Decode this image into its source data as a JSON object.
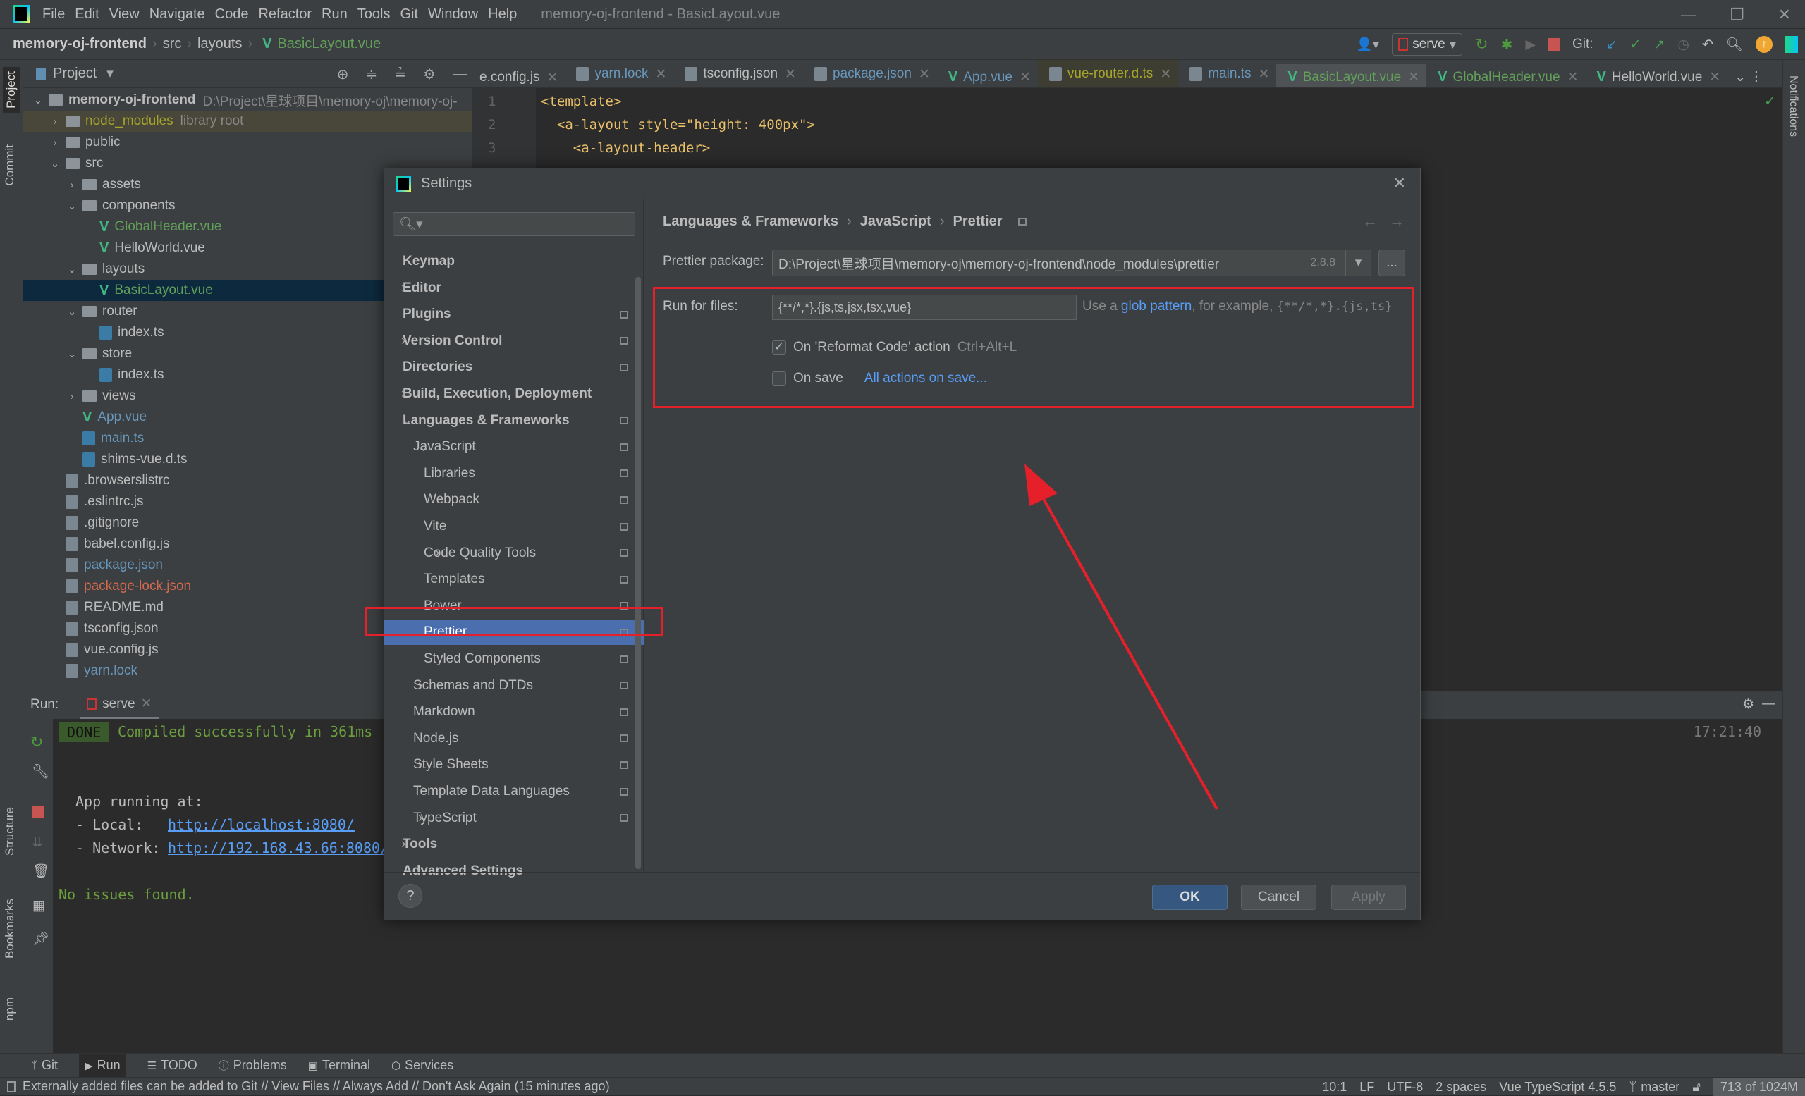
{
  "titlebar": {
    "menu": [
      "File",
      "Edit",
      "View",
      "Navigate",
      "Code",
      "Refactor",
      "Run",
      "Tools",
      "Git",
      "Window",
      "Help"
    ],
    "title": "memory-oj-frontend - BasicLayout.vue"
  },
  "navbar": {
    "breadcrumb": [
      "memory-oj-frontend",
      "src",
      "layouts",
      "BasicLayout.vue"
    ],
    "run_config": "serve",
    "git_label": "Git:"
  },
  "left_stripe": [
    "Project",
    "Commit",
    "Structure",
    "Bookmarks",
    "npm"
  ],
  "right_stripe": [
    "Notifications"
  ],
  "project": {
    "title": "Project",
    "tree": [
      {
        "label": "memory-oj-frontend",
        "extra": "D:\\Project\\星球项目\\memory-oj\\memory-oj-",
        "level": 0,
        "type": "folder",
        "open": true
      },
      {
        "label": "node_modules",
        "extra": "library root",
        "level": 1,
        "type": "folder",
        "open": false
      },
      {
        "label": "public",
        "level": 1,
        "type": "folder",
        "open": false
      },
      {
        "label": "src",
        "level": 1,
        "type": "folder",
        "open": true
      },
      {
        "label": "assets",
        "level": 2,
        "type": "folder",
        "open": false
      },
      {
        "label": "components",
        "level": 2,
        "type": "folder",
        "open": true
      },
      {
        "label": "GlobalHeader.vue",
        "level": 3,
        "type": "vue"
      },
      {
        "label": "HelloWorld.vue",
        "level": 3,
        "type": "vue"
      },
      {
        "label": "layouts",
        "level": 2,
        "type": "folder",
        "open": true
      },
      {
        "label": "BasicLayout.vue",
        "level": 3,
        "type": "vue",
        "selected": true
      },
      {
        "label": "router",
        "level": 2,
        "type": "folder",
        "open": true
      },
      {
        "label": "index.ts",
        "level": 3,
        "type": "ts"
      },
      {
        "label": "store",
        "level": 2,
        "type": "folder",
        "open": true
      },
      {
        "label": "index.ts",
        "level": 3,
        "type": "ts"
      },
      {
        "label": "views",
        "level": 2,
        "type": "folder",
        "open": false
      },
      {
        "label": "App.vue",
        "level": 2,
        "type": "vue"
      },
      {
        "label": "main.ts",
        "level": 2,
        "type": "ts"
      },
      {
        "label": "shims-vue.d.ts",
        "level": 2,
        "type": "ts"
      },
      {
        "label": ".browserslistrc",
        "level": 1,
        "type": "file"
      },
      {
        "label": ".eslintrc.js",
        "level": 1,
        "type": "file"
      },
      {
        "label": ".gitignore",
        "level": 1,
        "type": "file"
      },
      {
        "label": "babel.config.js",
        "level": 1,
        "type": "file"
      },
      {
        "label": "package.json",
        "level": 1,
        "type": "file"
      },
      {
        "label": "package-lock.json",
        "level": 1,
        "type": "file"
      },
      {
        "label": "README.md",
        "level": 1,
        "type": "file"
      },
      {
        "label": "tsconfig.json",
        "level": 1,
        "type": "file"
      },
      {
        "label": "vue.config.js",
        "level": 1,
        "type": "file"
      },
      {
        "label": "yarn.lock",
        "level": 1,
        "type": "file"
      }
    ]
  },
  "tabs": [
    {
      "label": "e.config.js"
    },
    {
      "label": "yarn.lock"
    },
    {
      "label": "tsconfig.json"
    },
    {
      "label": "package.json"
    },
    {
      "label": "App.vue"
    },
    {
      "label": "vue-router.d.ts"
    },
    {
      "label": "main.ts"
    },
    {
      "label": "BasicLayout.vue",
      "active": true
    },
    {
      "label": "GlobalHeader.vue"
    },
    {
      "label": "HelloWorld.vue"
    }
  ],
  "editor": {
    "lines": [
      {
        "n": "1",
        "code": "<template>"
      },
      {
        "n": "2",
        "code": "  <a-layout style=\"height: 400px\">"
      },
      {
        "n": "3",
        "code": "    <a-layout-header>"
      }
    ]
  },
  "run": {
    "label": "Run:",
    "tab": "serve",
    "done": "DONE",
    "compiled": "Compiled successfully in 361ms",
    "time": "17:21:40",
    "app_running": "App running at:",
    "local_label": "- Local:   ",
    "local_url": "http://localhost:8080/",
    "network_label": "- Network: ",
    "network_url": "http://192.168.43.66:8080/",
    "no_issues": "No issues found."
  },
  "toolwindows": [
    "Git",
    "Run",
    "TODO",
    "Problems",
    "Terminal",
    "Services"
  ],
  "status": {
    "message": "Externally added files can be added to Git // View Files // Always Add // Don't Ask Again (15 minutes ago)",
    "position": "10:1",
    "line_sep": "LF",
    "encoding": "UTF-8",
    "indent": "2 spaces",
    "lang": "Vue TypeScript 4.5.5",
    "branch": "master",
    "memory": "713 of 1024M"
  },
  "dialog": {
    "title": "Settings",
    "search_placeholder": "",
    "side": [
      {
        "label": "Keymap",
        "level": 0,
        "bold": true
      },
      {
        "label": "Editor",
        "level": 0,
        "bold": true,
        "arrow": "›"
      },
      {
        "label": "Plugins",
        "level": 0,
        "bold": true,
        "pin": true
      },
      {
        "label": "Version Control",
        "level": 0,
        "bold": true,
        "arrow": "›",
        "pin": true
      },
      {
        "label": "Directories",
        "level": 0,
        "bold": true,
        "pin": true
      },
      {
        "label": "Build, Execution, Deployment",
        "level": 0,
        "bold": true,
        "arrow": "›"
      },
      {
        "label": "Languages & Frameworks",
        "level": 0,
        "bold": true,
        "arrow": "⌄",
        "pin": true
      },
      {
        "label": "JavaScript",
        "level": 1,
        "arrow": "⌄",
        "pin": true
      },
      {
        "label": "Libraries",
        "level": 2,
        "pin": true
      },
      {
        "label": "Webpack",
        "level": 2,
        "pin": true
      },
      {
        "label": "Vite",
        "level": 2,
        "pin": true
      },
      {
        "label": "Code Quality Tools",
        "level": 2,
        "arrow": "›",
        "pin": true
      },
      {
        "label": "Templates",
        "level": 2,
        "pin": true
      },
      {
        "label": "Bower",
        "level": 2,
        "pin": true
      },
      {
        "label": "Prettier",
        "level": 2,
        "pin": true,
        "selected": true
      },
      {
        "label": "Styled Components",
        "level": 2,
        "pin": true
      },
      {
        "label": "Schemas and DTDs",
        "level": 1,
        "arrow": "›",
        "pin": true
      },
      {
        "label": "Markdown",
        "level": 1,
        "pin": true
      },
      {
        "label": "Node.js",
        "level": 1,
        "pin": true
      },
      {
        "label": "Style Sheets",
        "level": 1,
        "arrow": "›",
        "pin": true
      },
      {
        "label": "Template Data Languages",
        "level": 1,
        "pin": true
      },
      {
        "label": "TypeScript",
        "level": 1,
        "arrow": "›",
        "pin": true
      },
      {
        "label": "Tools",
        "level": 0,
        "bold": true,
        "arrow": "›"
      },
      {
        "label": "Advanced Settings",
        "level": 0,
        "bold": true
      }
    ],
    "breadcrumb": [
      "Languages & Frameworks",
      "JavaScript",
      "Prettier"
    ],
    "package_label": "Prettier package:",
    "package_value": "D:\\Project\\星球项目\\memory-oj\\memory-oj-frontend\\node_modules\\prettier",
    "package_version": "2.8.8",
    "browse": "...",
    "run_for_label": "Run for files:",
    "run_for_value": "{**/*,*}.{js,ts,jsx,tsx,vue}",
    "hint_pre": "Use a ",
    "hint_link": "glob pattern",
    "hint_post": ", for example, ",
    "hint_example": "{**/*,*}.{js,ts}",
    "reformat_label": "On 'Reformat Code' action",
    "reformat_checked": true,
    "reformat_shortcut": "Ctrl+Alt+L",
    "onsave_label": "On save",
    "onsave_checked": false,
    "all_actions": "All actions on save...",
    "ok": "OK",
    "cancel": "Cancel",
    "apply": "Apply",
    "help": "?"
  },
  "colors": {
    "annotation": "#e5202a",
    "accent": "#365880",
    "link": "#589df6",
    "vue": "#41b883"
  }
}
